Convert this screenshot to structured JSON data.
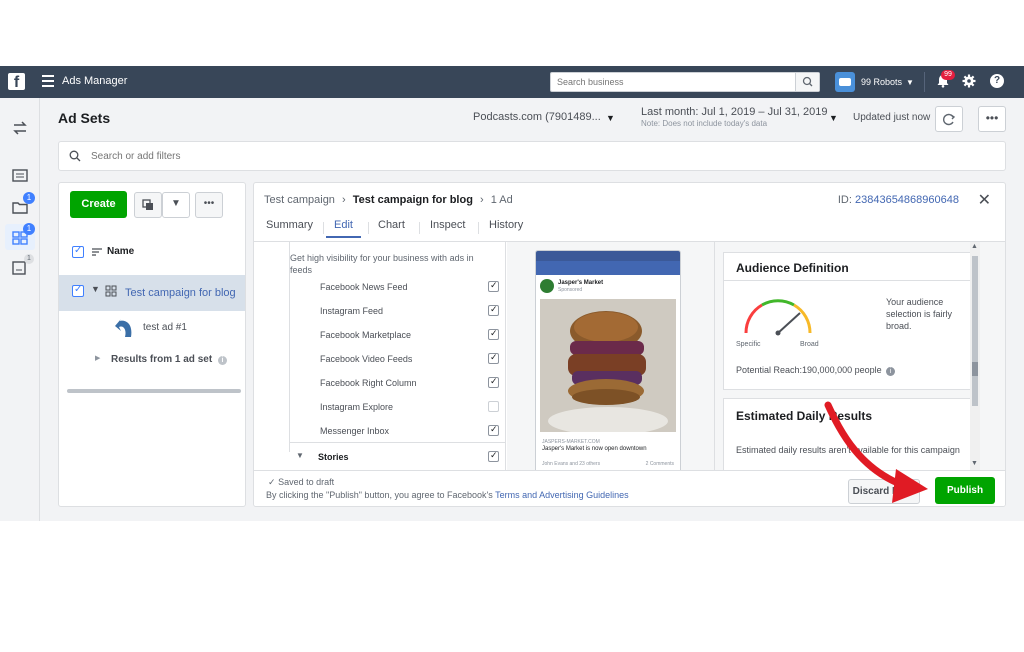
{
  "topbar": {
    "logo": "f",
    "app_title": "Ads Manager",
    "search_placeholder": "Search business",
    "account_name": "99 Robots",
    "notification_count": "99"
  },
  "rail": {
    "badges": [
      "1",
      "1",
      "1"
    ]
  },
  "header": {
    "title": "Ad Sets",
    "account_select": "Podcasts.com (7901489...",
    "date_range": "Last month: Jul 1, 2019 – Jul 31, 2019",
    "date_note": "Note: Does not include today's data",
    "updated": "Updated just now",
    "more_label": "•••"
  },
  "filter": {
    "placeholder": "Search or add filters"
  },
  "left_panel": {
    "create_label": "Create",
    "more_label": "•••",
    "name_header": "Name",
    "campaign_name": "Test campaign for blog",
    "ad_name": "test ad #1",
    "results_label": "Results from 1 ad set"
  },
  "editor": {
    "breadcrumb": [
      "Test campaign",
      "Test campaign for blog",
      "1 Ad"
    ],
    "id_label": "ID:",
    "id_value": "23843654868960648",
    "tabs": [
      "Summary",
      "Edit",
      "Chart",
      "Inspect",
      "History"
    ],
    "active_tab": "Edit",
    "placement_desc": "Get high visibility for your business with ads in feeds",
    "placements": [
      {
        "label": "Facebook News Feed",
        "checked": true
      },
      {
        "label": "Instagram Feed",
        "checked": true
      },
      {
        "label": "Facebook Marketplace",
        "checked": true
      },
      {
        "label": "Facebook Video Feeds",
        "checked": true
      },
      {
        "label": "Facebook Right Column",
        "checked": true
      },
      {
        "label": "Instagram Explore",
        "checked": false
      },
      {
        "label": "Messenger Inbox",
        "checked": true
      }
    ],
    "stories_label": "Stories",
    "preview": {
      "page_name": "Jasper's Market",
      "sponsored": "Sponsored",
      "link_url": "JASPERS-MARKET.COM",
      "link_title": "Jasper's Market is now open downtown",
      "reactions": "John Evans and 23 others",
      "comments": "2 Comments"
    },
    "audience": {
      "title": "Audience Definition",
      "text": "Your audience selection is fairly broad.",
      "specific": "Specific",
      "broad": "Broad",
      "reach": "Potential Reach:190,000,000 people"
    },
    "estimated": {
      "title": "Estimated Daily Results",
      "text": "Estimated daily results aren't available for this campaign"
    },
    "footer": {
      "saved": "Saved to draft",
      "terms_prefix": "By clicking the \"Publish\" button, you agree to Facebook's",
      "terms_link": "Terms and Advertising Guidelines",
      "discard": "Discard Draft",
      "publish": "Publish"
    }
  },
  "colors": {
    "topbar": "#384658",
    "accent": "#4267b2",
    "green": "#00a400",
    "arrow": "#e01b24"
  }
}
